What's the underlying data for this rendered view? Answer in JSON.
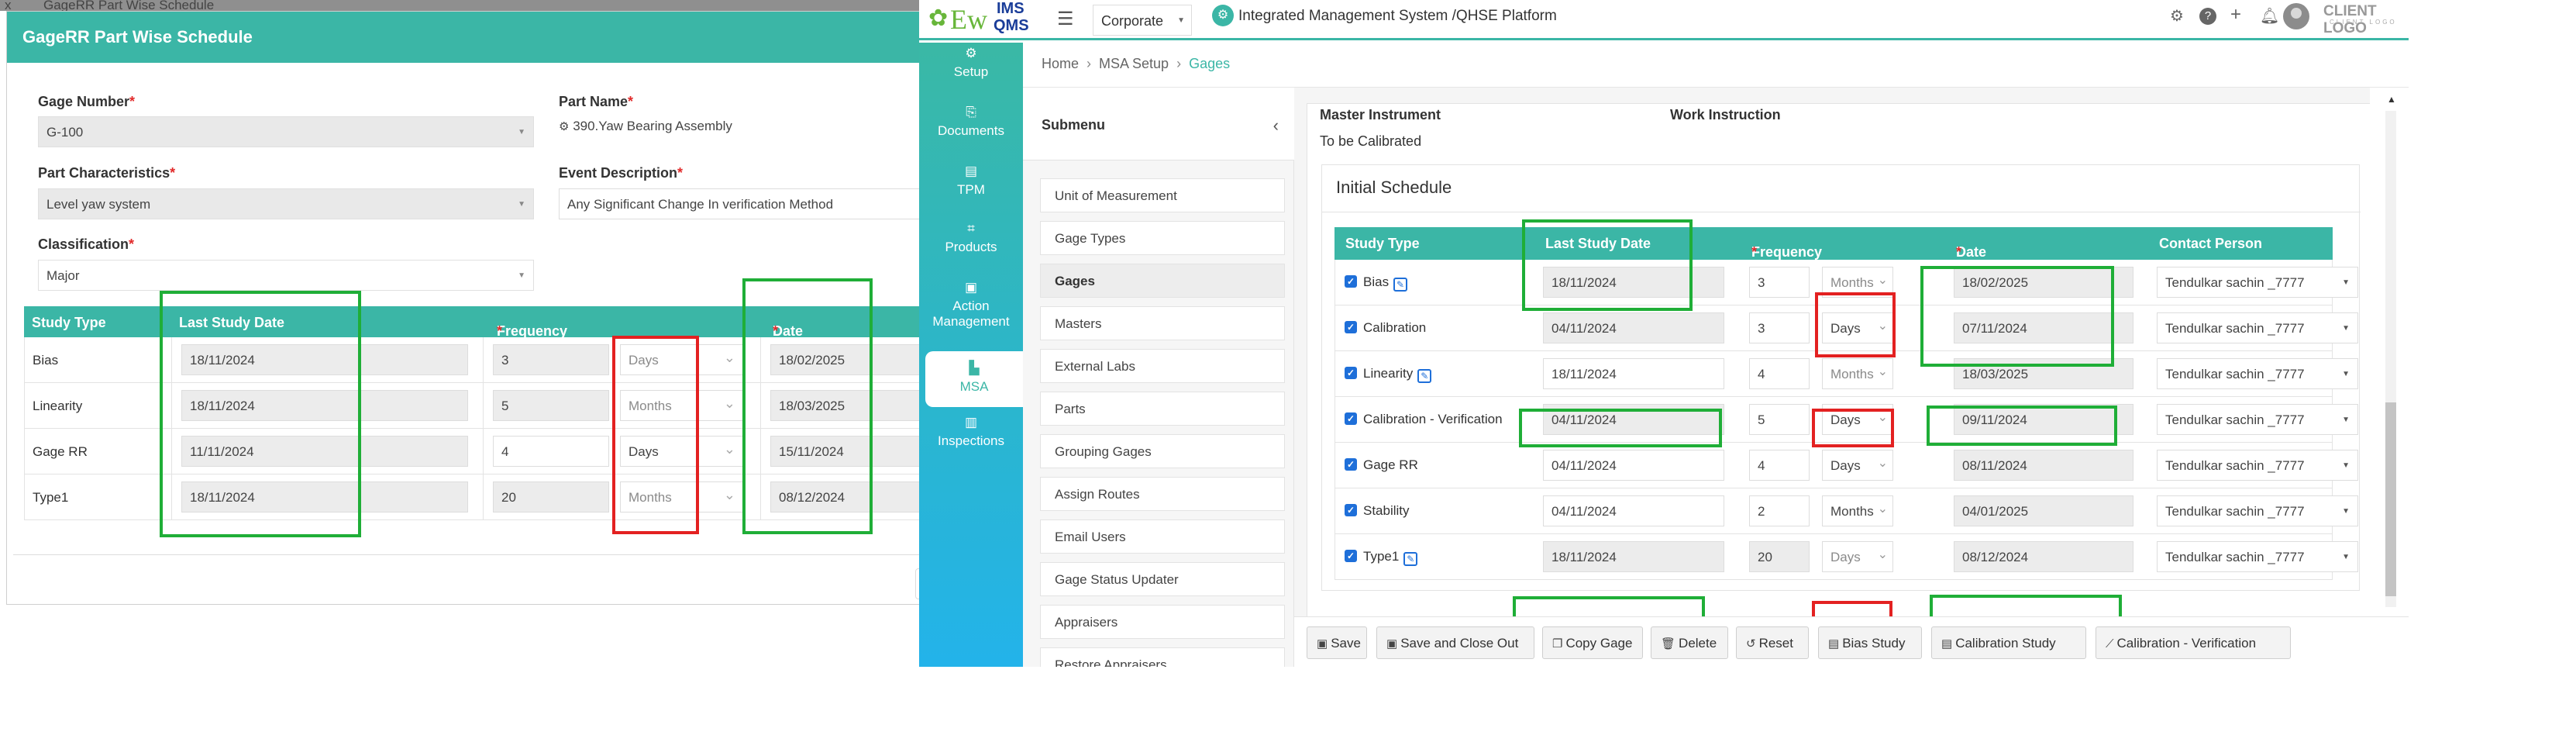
{
  "background_window": {
    "title": "GageRR Part Wise Schedule",
    "close_glyph": "x"
  },
  "left_modal": {
    "title": "GageRR Part Wise Schedule",
    "gage_number": {
      "label": "Gage Number",
      "value": "G-100"
    },
    "part_name": {
      "label": "Part Name",
      "value": "390.Yaw Bearing Assembly"
    },
    "part_characteristics": {
      "label": "Part Characteristics",
      "value": "Level yaw system"
    },
    "event_description": {
      "label": "Event Description",
      "value": "Any Significant Change In verification Method"
    },
    "classification": {
      "label": "Classification",
      "value": "Major"
    },
    "table": {
      "columns": [
        "Study Type",
        "Last Study Date",
        "Frequency",
        "Date"
      ],
      "rows": [
        {
          "study_type": "Bias",
          "last_study_date": "18/11/2024",
          "frequency": "3",
          "unit": "Days",
          "date": "18/02/2025"
        },
        {
          "study_type": "Linearity",
          "last_study_date": "18/11/2024",
          "frequency": "5",
          "unit": "Months",
          "date": "18/03/2025"
        },
        {
          "study_type": "Gage RR",
          "last_study_date": "11/11/2024",
          "frequency": "4",
          "unit": "Days",
          "date": "15/11/2024"
        },
        {
          "study_type": "Type1",
          "last_study_date": "18/11/2024",
          "frequency": "20",
          "unit": "Months",
          "date": "08/12/2024"
        }
      ]
    }
  },
  "topbar": {
    "logo": {
      "ew": "Ew",
      "ims": "IMS",
      "qms": "QMS"
    },
    "company": "Corporate",
    "platform_title": "Integrated Management System /QHSE Platform",
    "client_logo": "CLIENT LOGO",
    "client_logo_sub": "CLIENT LOGO",
    "icons": [
      "gear-icon",
      "help-icon",
      "plus-icon",
      "bell-icon",
      "avatar"
    ]
  },
  "sidebar": {
    "items": [
      {
        "label": "Setup",
        "icon": "gears-icon"
      },
      {
        "label": "Documents",
        "icon": "documents-icon"
      },
      {
        "label": "TPM",
        "icon": "tpm-icon"
      },
      {
        "label": "Products",
        "icon": "products-icon"
      },
      {
        "label": "Action Management",
        "icon": "action-icon"
      },
      {
        "label": "MSA",
        "icon": "chart-icon"
      },
      {
        "label": "Inspections",
        "icon": "inspections-icon"
      }
    ]
  },
  "breadcrumb": {
    "items": [
      "Home",
      "MSA Setup",
      "Gages"
    ]
  },
  "submenu": {
    "title": "Submenu",
    "items": [
      "Unit of Measurement",
      "Gage Types",
      "Gages",
      "Masters",
      "External Labs",
      "Parts",
      "Grouping Gages",
      "Assign Routes",
      "Email Users",
      "Gage Status Updater",
      "Appraisers",
      "Restore Appraisers"
    ]
  },
  "main": {
    "master_instrument_label": "Master Instrument",
    "work_instruction_label": "Work Instruction",
    "to_be_calibrated": "To be Calibrated",
    "initial_schedule_title": "Initial Schedule",
    "table": {
      "columns": [
        "Study Type",
        "Last Study Date",
        "Frequency",
        "Date",
        "Contact Person"
      ],
      "rows": [
        {
          "study_type": "Bias",
          "last_study_date": "18/11/2024",
          "frequency": "3",
          "unit": "Months",
          "date": "18/02/2025",
          "contact": "Tendulkar sachin _7777"
        },
        {
          "study_type": "Calibration",
          "last_study_date": "04/11/2024",
          "frequency": "3",
          "unit": "Days",
          "date": "07/11/2024",
          "contact": "Tendulkar sachin _7777"
        },
        {
          "study_type": "Linearity",
          "last_study_date": "18/11/2024",
          "frequency": "4",
          "unit": "Months",
          "date": "18/03/2025",
          "contact": "Tendulkar sachin _7777"
        },
        {
          "study_type": "Calibration - Verification",
          "last_study_date": "04/11/2024",
          "frequency": "5",
          "unit": "Days",
          "date": "09/11/2024",
          "contact": "Tendulkar sachin _7777"
        },
        {
          "study_type": "Gage RR",
          "last_study_date": "04/11/2024",
          "frequency": "4",
          "unit": "Days",
          "date": "08/11/2024",
          "contact": "Tendulkar sachin _7777"
        },
        {
          "study_type": "Stability",
          "last_study_date": "04/11/2024",
          "frequency": "2",
          "unit": "Months",
          "date": "04/01/2025",
          "contact": "Tendulkar sachin _7777"
        },
        {
          "study_type": "Type1",
          "last_study_date": "18/11/2024",
          "frequency": "20",
          "unit": "Days",
          "date": "08/12/2024",
          "contact": "Tendulkar sachin _7777"
        }
      ]
    },
    "buttons": {
      "save": "Save",
      "save_close": "Save and Close Out",
      "copy_gage": "Copy Gage",
      "delete": "Delete",
      "reset": "Reset",
      "bias_study": "Bias Study",
      "calibration_study": "Calibration Study",
      "calibration_verification": "Calibration - Verification"
    }
  },
  "colors": {
    "teal": "#3bb6a6",
    "highlight_green": "#1fae37",
    "highlight_red": "#e32121",
    "checkbox_blue": "#1e6fd9"
  }
}
